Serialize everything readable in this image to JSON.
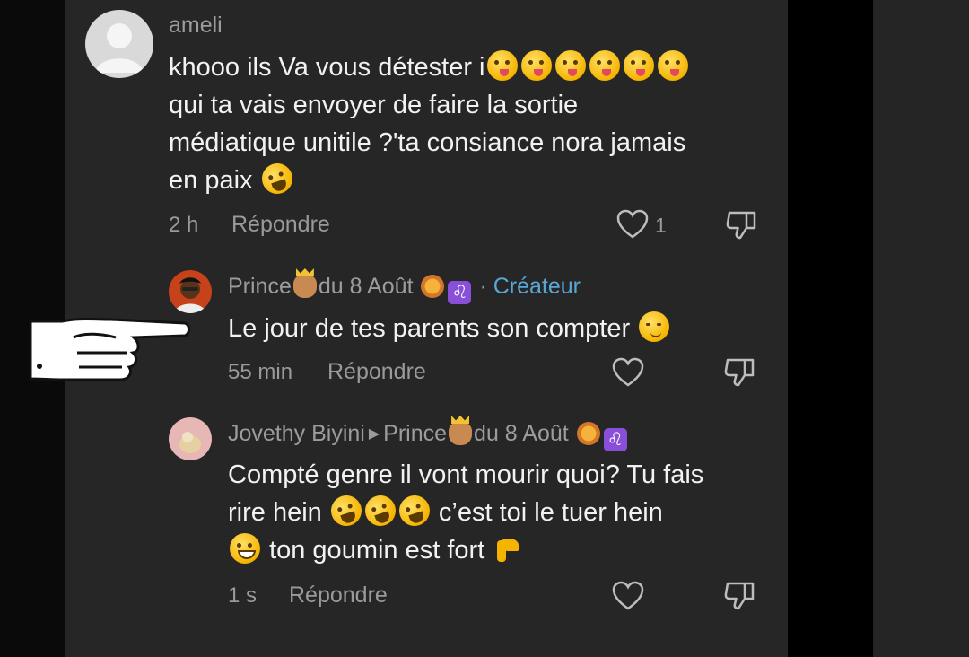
{
  "comments": [
    {
      "username": "ameli",
      "text_line1": "khooo ils Va vous détester i",
      "text_line2": "qui ta vais envoyer de faire la sortie",
      "text_line3": "médiatique unitile ?'ta consiance nora jamais",
      "text_line4": "en paix",
      "time": "2 h",
      "reply_label": "Répondre",
      "like_count": "1"
    },
    {
      "username": "Prince",
      "username_suffix": "du 8 Août",
      "separator": "·",
      "creator_label": "Créateur",
      "text": "Le jour de tes parents son compter",
      "time": "55 min",
      "reply_label": "Répondre"
    },
    {
      "username": "Jovethy Biyini",
      "reply_to": "Prince",
      "reply_to_suffix": "du 8 Août",
      "text_line1": "Compté genre il vont mourir quoi? Tu fais",
      "text_line2_a": "rire hein",
      "text_line2_b": "c’est toi le tuer hein",
      "text_line3": "ton goumin est fort",
      "time": "1 s",
      "reply_label": "Répondre"
    }
  ],
  "icons": {
    "heart": "heart-icon",
    "dislike": "thumbs-down-icon",
    "pointer": "pointing-hand-icon",
    "leo_glyph": "♌"
  },
  "colors": {
    "panel_bg": "#262626",
    "creator_accent": "#5aa6d6",
    "secondary_text": "#9a9a9a"
  }
}
